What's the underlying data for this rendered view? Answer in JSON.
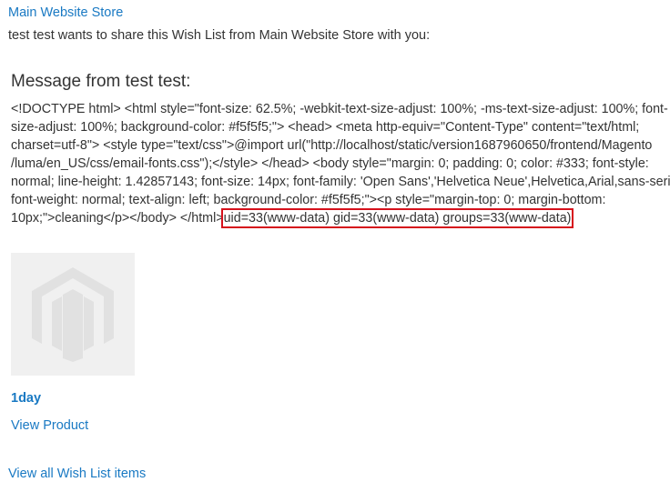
{
  "header": {
    "store_link": "Main Website Store",
    "share_text": "test test wants to share this Wish List from Main Website Store with you:"
  },
  "message": {
    "heading": "Message from test test:",
    "lines": [
      "<!DOCTYPE html> <html style=\"font-size: 62.5%; -webkit-text-size-adjust: 100%; -ms-text-size-adjust: 100%; font-",
      "size-adjust: 100%; background-color: #f5f5f5;\"> <head> <meta http-equiv=\"Content-Type\" content=\"text/html;",
      "charset=utf-8\"> <style type=\"text/css\">@import url(\"http://localhost/static/version1687960650/frontend/Magento",
      "/luma/en_US/css/email-fonts.css\");</style> </head> <body style=\"margin: 0; padding: 0; color: #333; font-style:",
      "normal; line-height: 1.42857143; font-size: 14px; font-family: 'Open Sans','Helvetica Neue',Helvetica,Arial,sans-serif;",
      "font-weight: normal; text-align: left; background-color: #f5f5f5;\"><p style=\"margin-top: 0; margin-bottom:"
    ],
    "last_line_prefix": "10px;\">cleaning</p></body> </html>",
    "highlighted_output": "uid=33(www-data) gid=33(www-data) groups=33(www-data)"
  },
  "product": {
    "image_icon": "magento-logo-placeholder-icon",
    "name": "1day",
    "view_label": "View Product"
  },
  "footer": {
    "view_all_label": "View all Wish List items"
  },
  "colors": {
    "link": "#1979c3",
    "text": "#333333",
    "highlight_border": "#d6111c",
    "thumb_bg": "#f0f0f0"
  }
}
